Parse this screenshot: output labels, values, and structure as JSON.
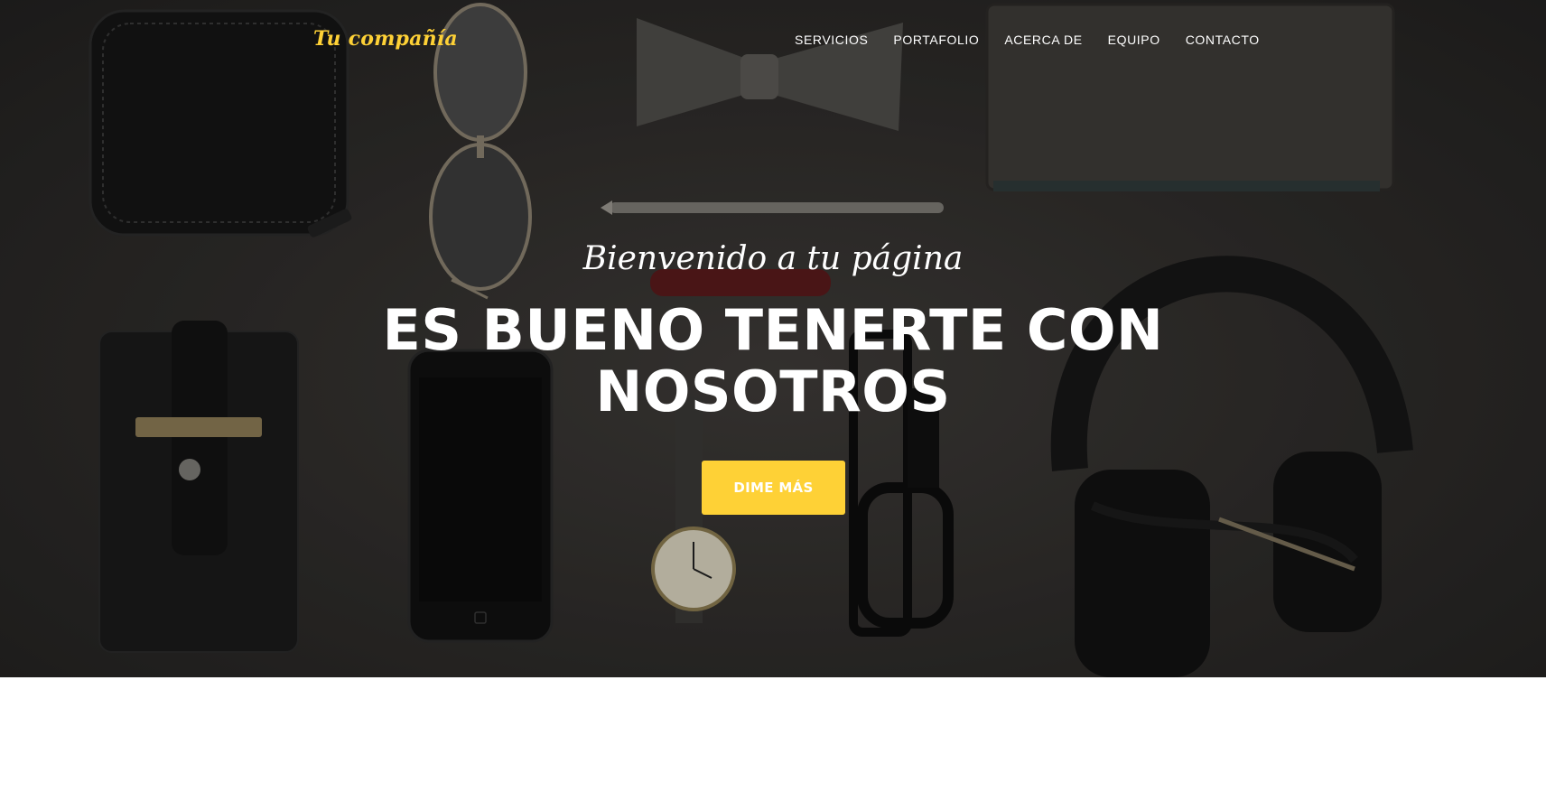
{
  "brand": {
    "name": "Tu compañía"
  },
  "nav": {
    "items": [
      {
        "label": "SERVICIOS"
      },
      {
        "label": "PORTAFOLIO"
      },
      {
        "label": "ACERCA DE"
      },
      {
        "label": "EQUIPO"
      },
      {
        "label": "CONTACTO"
      }
    ]
  },
  "hero": {
    "lead_in": "Bienvenido a tu página",
    "heading": "ES BUENO TENERTE CON NOSOTROS",
    "cta_label": "DIME MÁS"
  },
  "colors": {
    "accent": "#fed136",
    "hero_background": "#2e2c2a",
    "text_on_hero": "#ffffff",
    "page_background": "#ffffff"
  }
}
